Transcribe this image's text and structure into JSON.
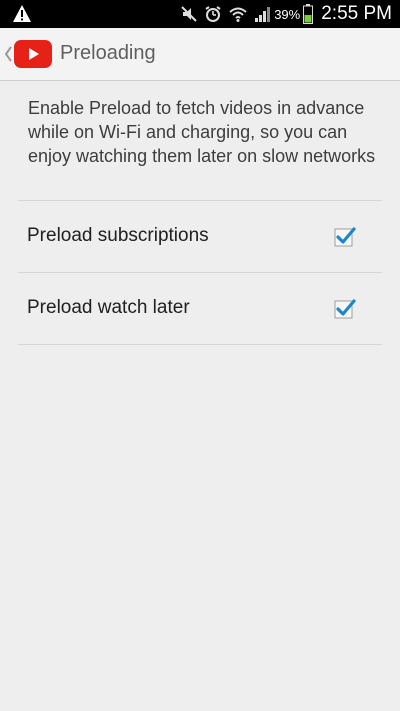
{
  "status_bar": {
    "battery_percent": "39%",
    "time": "2:55 PM",
    "icons": [
      "warning-icon",
      "mute-icon",
      "alarm-icon",
      "wifi-icon",
      "signal-icon",
      "battery-icon"
    ]
  },
  "action_bar": {
    "title": "Preloading",
    "icons": [
      "back-chevron-icon",
      "youtube-logo-icon"
    ]
  },
  "settings": {
    "description": "Enable Preload to fetch videos in advance while on Wi-Fi and charging, so you can enjoy watching them later on slow networks",
    "items": [
      {
        "label": "Preload subscriptions",
        "checked": true
      },
      {
        "label": "Preload watch later",
        "checked": true
      }
    ]
  },
  "colors": {
    "checkmark": "#1e88c7",
    "youtube_red": "#e62117"
  }
}
